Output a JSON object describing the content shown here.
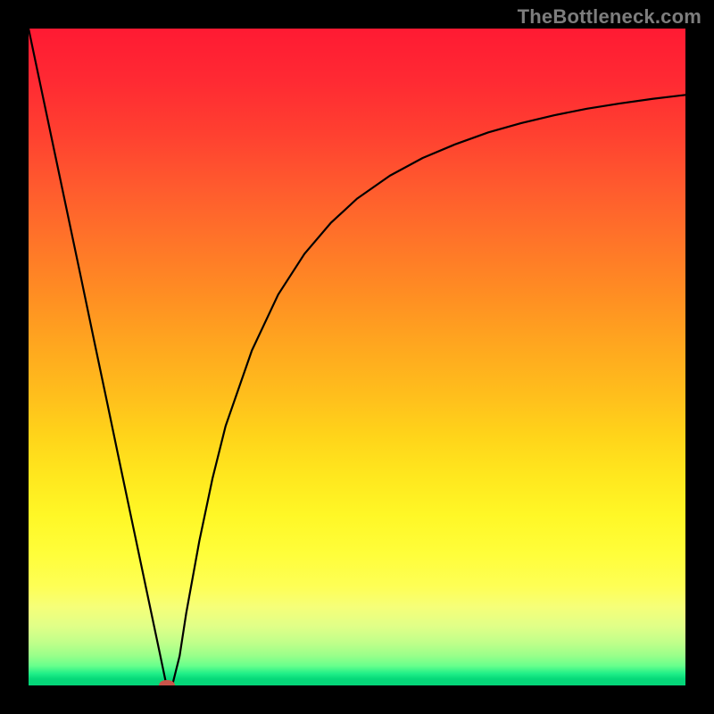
{
  "watermark": "TheBottleneck.com",
  "colors": {
    "frame": "#000000",
    "curve": "#000000",
    "marker": "#c9544a",
    "gradient_top": "#ff1a33",
    "gradient_bottom": "#05d579"
  },
  "chart_data": {
    "type": "line",
    "title": "",
    "xlabel": "",
    "ylabel": "",
    "xlim": [
      0,
      100
    ],
    "ylim": [
      0,
      100
    ],
    "grid": false,
    "legend": false,
    "x": [
      0,
      2,
      4,
      6,
      8,
      10,
      12,
      14,
      16,
      18,
      20,
      21,
      22,
      23,
      24,
      26,
      28,
      30,
      34,
      38,
      42,
      46,
      50,
      55,
      60,
      65,
      70,
      75,
      80,
      85,
      90,
      95,
      100
    ],
    "y": [
      100,
      90.5,
      81,
      71.5,
      62,
      52.4,
      42.9,
      33.3,
      23.8,
      14.3,
      4.8,
      0,
      0.5,
      4.5,
      11,
      22,
      31.5,
      39.5,
      51,
      59.5,
      65.7,
      70.4,
      74.1,
      77.6,
      80.3,
      82.4,
      84.2,
      85.6,
      86.8,
      87.8,
      88.6,
      89.3,
      89.9
    ],
    "marker": {
      "x": 21,
      "y": 0
    }
  }
}
